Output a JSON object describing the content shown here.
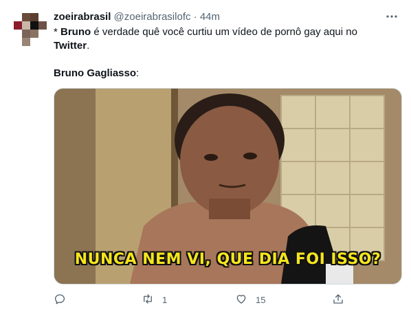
{
  "author": {
    "display_name": "zoeirabrasil",
    "handle": "@zoeirabrasilofc",
    "separator": "·",
    "timestamp": "44m"
  },
  "tweet": {
    "line1_prefix": "* ",
    "line1_bold": "Bruno",
    "line1_rest": " é verdade quê você curtiu um vídeo de pornô gay aqui no",
    "line2_bold": "Twitter",
    "line2_rest": ".",
    "line3_bold": "Bruno Gagliasso",
    "line3_rest": ":"
  },
  "media": {
    "caption": "NUNCA NEM VI, QUE DIA FOI ISSO?"
  },
  "actions": {
    "reply_icon": "reply-icon",
    "retweet_icon": "retweet-icon",
    "retweet_count": "1",
    "like_icon": "heart-icon",
    "like_count": "15",
    "share_icon": "share-icon"
  },
  "colors": {
    "secondary_text": "#536471",
    "caption_yellow": "#f5e51c"
  }
}
